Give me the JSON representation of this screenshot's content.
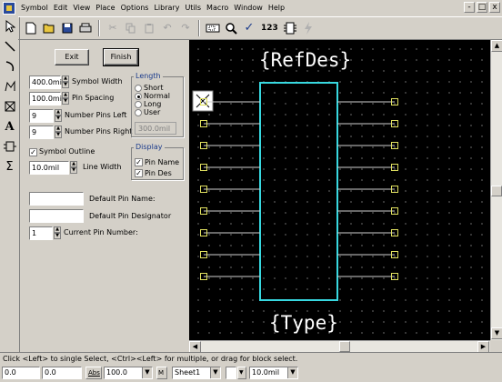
{
  "menu": [
    "Symbol",
    "Edit",
    "View",
    "Place",
    "Options",
    "Library",
    "Utils",
    "Macro",
    "Window",
    "Help"
  ],
  "window_controls": [
    "-",
    "□",
    "x"
  ],
  "toolbar": {
    "icons": [
      "new-icon",
      "open-icon",
      "save-icon",
      "print-icon",
      "cut-icon",
      "copy-icon",
      "paste-icon",
      "undo-icon",
      "redo-icon",
      "zoom-window-icon",
      "zoom-icon",
      "check-icon",
      "autonumber-icon",
      "pin-icon",
      "lightning-icon"
    ],
    "numbering_label": "123"
  },
  "left_tools": [
    "select-arrow-icon",
    "line-icon",
    "arc-icon",
    "polygon-icon",
    "pin-box-icon",
    "text-icon",
    "symbol-icon",
    "sum-icon"
  ],
  "panel": {
    "exit_label": "Exit",
    "finish_label": "Finish",
    "symbol_width_value": "400.0mil",
    "symbol_width_label": "Symbol Width",
    "pin_spacing_value": "100.0mil",
    "pin_spacing_label": "Pin Spacing",
    "pins_left_value": "9",
    "pins_left_label": "Number Pins Left",
    "pins_right_value": "9",
    "pins_right_label": "Number Pins Right",
    "symbol_outline_label": "Symbol Outline",
    "symbol_outline_checked": true,
    "line_width_value": "10.0mil",
    "line_width_label": "Line Width",
    "length_title": "Length",
    "length_options": [
      "Short",
      "Normal",
      "Long",
      "User"
    ],
    "length_selected": "Normal",
    "user_length_value": "300.0mil",
    "display_title": "Display",
    "pin_name_label": "Pin Name",
    "pin_des_label": "Pin Des",
    "default_pin_name_label": "Default Pin Name:",
    "default_pin_name_value": "",
    "default_pin_designator_label": "Default Pin Designator",
    "default_pin_designator_value": "",
    "current_pin_number_value": "1",
    "current_pin_number_label": "Current Pin Number:"
  },
  "canvas": {
    "refdes_text": "{RefDes}",
    "type_text": "{Type}",
    "colors": {
      "background": "#000000",
      "body": "#38d8e0",
      "pin": "#e0e060",
      "pin_line": "#d0d0d0",
      "grid": "#7a7a7a"
    }
  },
  "status_text": "Click <Left> to single Select, <Ctrl><Left> for multiple, or drag for block select.",
  "bottom": {
    "x_coord": "0.0",
    "y_coord": "0.0",
    "abs_label": "Abs",
    "zoom_value": "100.0",
    "m_label": "M",
    "sheet_value": "Sheet1",
    "line_width_value": "10.0mil"
  }
}
